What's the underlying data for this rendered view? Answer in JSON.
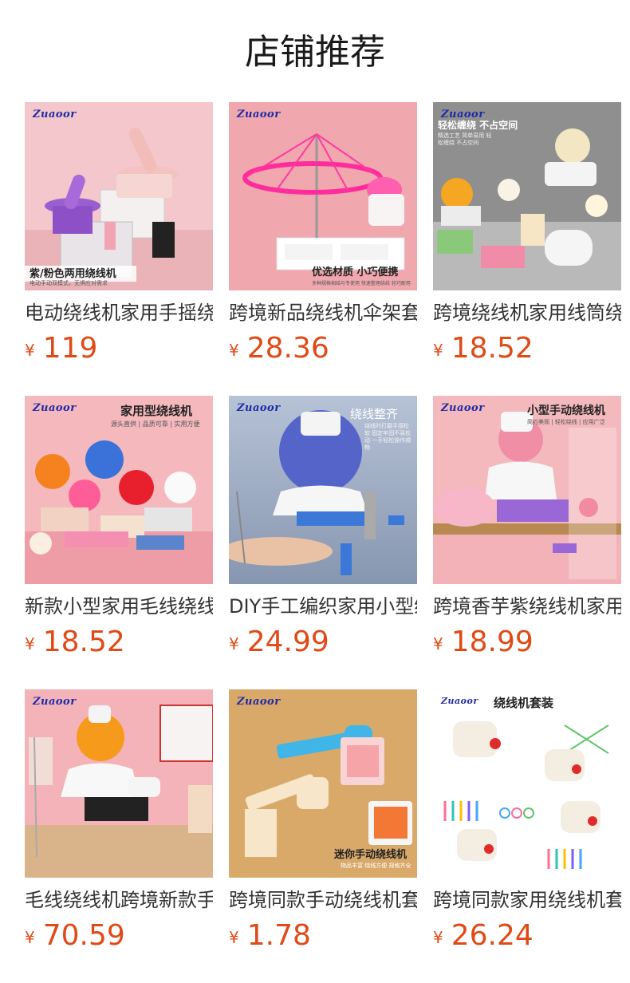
{
  "header": {
    "title": "店铺推荐"
  },
  "currency_symbol": "¥",
  "products": [
    {
      "name": "电动绕线机家用手摇绕线器",
      "price": "119",
      "brand": "Zuaoor",
      "banner": "紫/粉色两用绕线机",
      "banner_sub": "电动手动双模式，无惧应对需求"
    },
    {
      "name": "跨境新品绕线机伞架套装",
      "price": "28.36",
      "brand": "Zuaoor",
      "banner": "优选材质  小巧便携",
      "banner_sub": "多种规格相结与专使用  快速整理绕线  轻巧耐用"
    },
    {
      "name": "跨境绕线机家用线筒绕线器",
      "price": "18.52",
      "brand": "Zuaoor",
      "banner": "轻松缠绕 不占空间",
      "banner_sub": "精选工艺 简单易用 轻松缠绕 不占空间"
    },
    {
      "name": "新款小型家用毛线绕线器",
      "price": "18.52",
      "brand": "Zuaoor",
      "banner": "家用型绕线机",
      "banner_sub": "源头直供 | 品质可靠 | 实用方便"
    },
    {
      "name": "DIY手工编织家用小型绕线机",
      "price": "24.99",
      "brand": "Zuaoor",
      "banner": "绕线整齐",
      "banner_sub": "绕线时打磨手感松软 固定牢固不易松动 一手轻松操作顺畅"
    },
    {
      "name": "跨境香芋紫绕线机家用",
      "price": "18.99",
      "brand": "Zuaoor",
      "banner": "小型手动绕线机",
      "banner_sub": "简约美观 | 轻松绕线 | 应用广泛"
    },
    {
      "name": "毛线绕线机跨境新款手摇",
      "price": "70.59",
      "brand": "Zuaoor",
      "banner": "",
      "banner_sub": ""
    },
    {
      "name": "跨境同款手动绕线机套装",
      "price": "1.78",
      "brand": "Zuaoor",
      "banner": "迷你手动绕线机",
      "banner_sub": "物品丰富  绕线方便  规格齐全"
    },
    {
      "name": "跨境同款家用绕线机套装",
      "price": "26.24",
      "brand": "Zuaoor",
      "banner": "绕线机套装",
      "banner_sub": ""
    }
  ],
  "colors": {
    "price": "#e04a16",
    "brand": "#1d2aa6",
    "title": "#1a1a1a"
  }
}
